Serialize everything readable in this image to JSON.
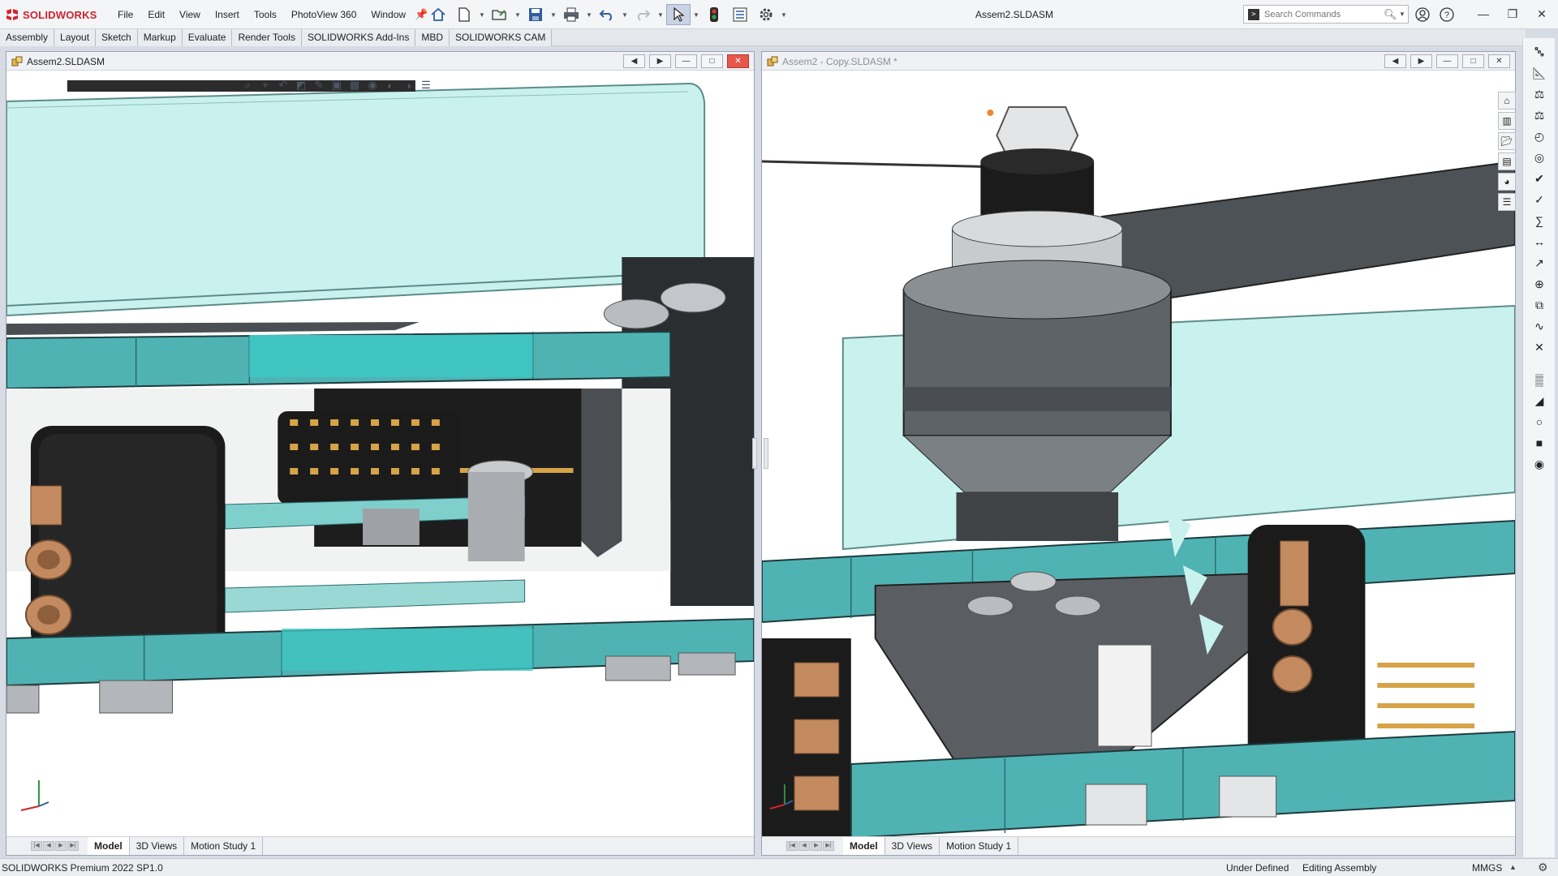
{
  "app": {
    "brand": "SOLIDWORKS",
    "accent_color": "#d1232a",
    "window_title": "Assem2.SLDASM"
  },
  "menu": {
    "items": [
      "File",
      "Edit",
      "View",
      "Insert",
      "Tools",
      "PhotoView 360",
      "Window"
    ]
  },
  "quick_toolbar": {
    "icons": [
      "home-icon",
      "new-document-icon",
      "open-folder-icon",
      "save-icon",
      "print-icon",
      "undo-icon",
      "redo-icon",
      "select-cursor-icon",
      "traffic-light-icon",
      "file-properties-icon",
      "options-gear-icon"
    ]
  },
  "search": {
    "placeholder": "Search Commands"
  },
  "command_tabs": {
    "items": [
      "Assembly",
      "Layout",
      "Sketch",
      "Markup",
      "Evaluate",
      "Render Tools",
      "SOLIDWORKS Add-Ins",
      "MBD",
      "SOLIDWORKS CAM"
    ]
  },
  "viewports": {
    "left": {
      "title": "Assem2.SLDASM",
      "tabs": [
        "Model",
        "3D Views",
        "Motion Study 1"
      ],
      "active_tab": "Model"
    },
    "right": {
      "title": "Assem2 - Copy.SLDASM *",
      "tabs": [
        "Model",
        "3D Views",
        "Motion Study 1"
      ],
      "active_tab": "Model"
    }
  },
  "model_colors": {
    "teal_plate": "#4fb3b4",
    "light_cyan_cover": "#c9f2ee",
    "black_part": "#1b1b1b",
    "dark_gray_part": "#3f4346",
    "metal_silver": "#b9bdc1",
    "copper": "#c38a5f",
    "gold_pins": "#d6a347"
  },
  "status": {
    "app_version": "SOLIDWORKS Premium 2022 SP1.0",
    "definition": "Under Defined",
    "mode": "Editing Assembly",
    "units": "MMGS"
  }
}
